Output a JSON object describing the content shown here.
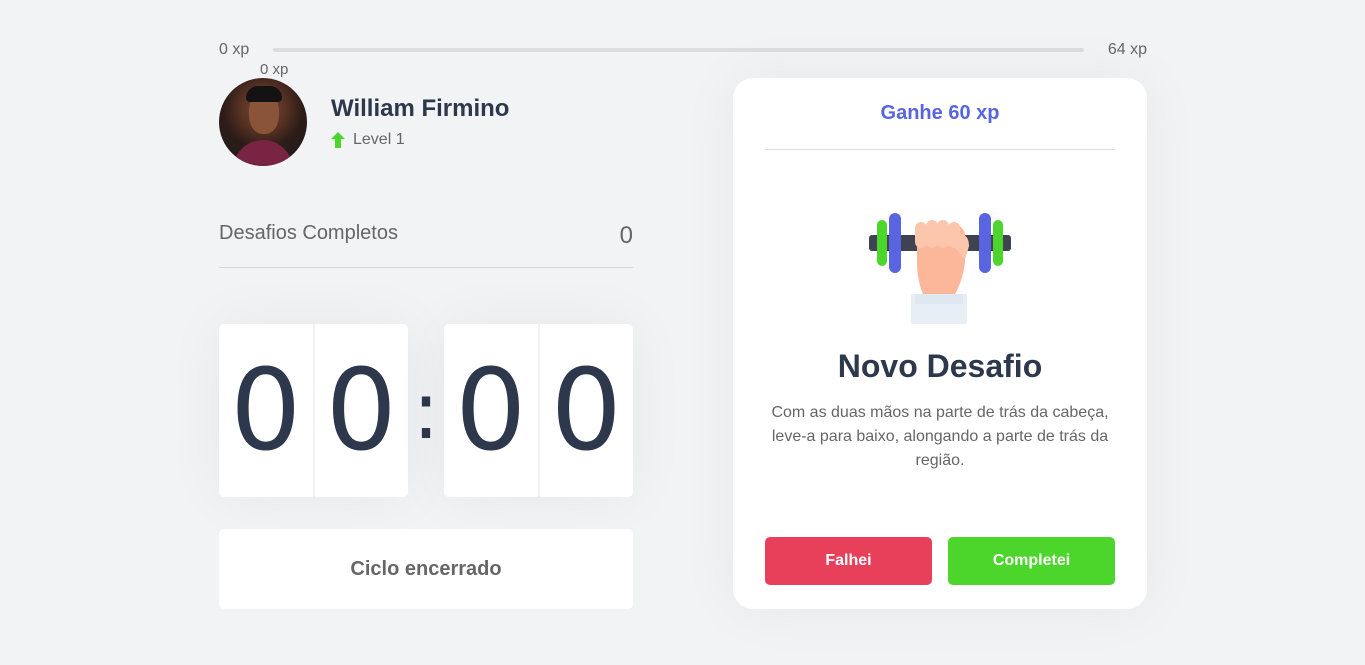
{
  "xp": {
    "min_label": "0 xp",
    "max_label": "64 xp",
    "current_label": "0 xp",
    "progress": 0
  },
  "profile": {
    "name": "William Firmino",
    "level": "Level 1"
  },
  "completed": {
    "label": "Desafios Completos",
    "count": "0"
  },
  "countdown": {
    "minute_left": "0",
    "minute_right": "0",
    "colon": ":",
    "second_left": "0",
    "second_right": "0"
  },
  "cycle_button": "Ciclo encerrado",
  "challenge": {
    "reward": "Ganhe 60 xp",
    "title": "Novo Desafio",
    "description": "Com as duas mãos na parte de trás da cabeça, leve-a para baixo, alongando a parte de trás da região.",
    "fail_label": "Falhei",
    "success_label": "Completei"
  },
  "colors": {
    "accent": "#5965e0",
    "fail": "#e83f5b",
    "success": "#4cd62b",
    "title": "#2e384d",
    "text": "#666666"
  },
  "icons": [
    "level-up-arrow-icon",
    "dumbbell-icon"
  ]
}
